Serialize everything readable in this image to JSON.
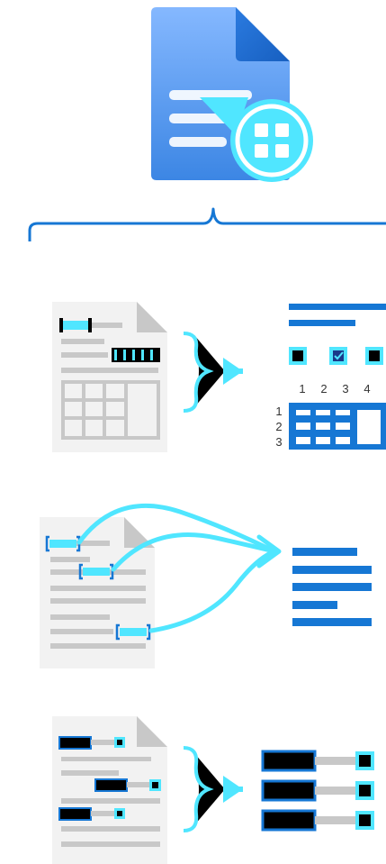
{
  "colors": {
    "doc_blue_light": "#85b8ff",
    "doc_blue_mid": "#4a90e8",
    "doc_blue_dark": "#1f6fd6",
    "cyan": "#50e6ff",
    "accent_blue": "#1677d4",
    "paper": "#f2f2f2",
    "paper_fold": "#c8c8c8",
    "line_gray": "#c8c8c8",
    "black": "#000000"
  },
  "icons": {
    "top": "document-intelligence-icon",
    "row1_input": "form-document-icon",
    "row1_output": "structured-layout-icon",
    "row2_input": "document-key-fields-icon",
    "row2_output": "extracted-text-lines-icon",
    "row3_input": "document-key-value-icon",
    "row3_output": "key-value-pairs-icon"
  },
  "table": {
    "col_labels": [
      "1",
      "2",
      "3",
      "4"
    ],
    "row_labels": [
      "1",
      "2",
      "3"
    ]
  }
}
